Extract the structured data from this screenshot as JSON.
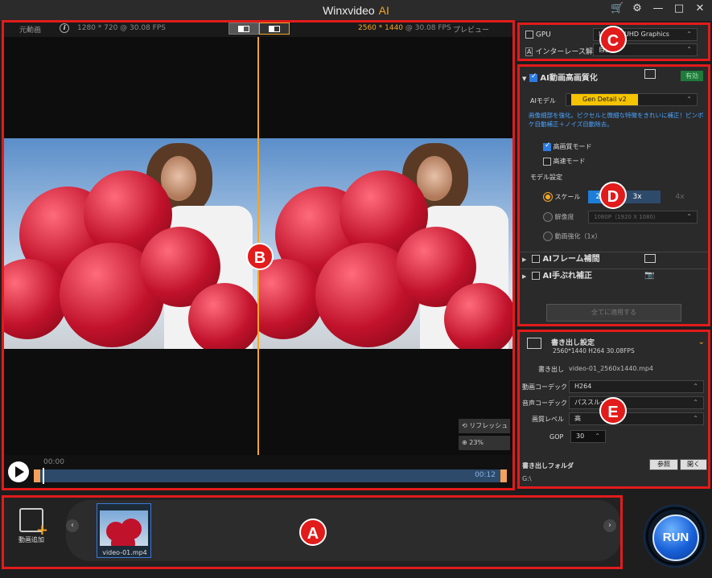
{
  "app": {
    "title": "Winxvideo",
    "title_ai": "AI"
  },
  "preview": {
    "left_label": "元動画",
    "left_res": "1280 * 720 @ 30.08 FPS",
    "right_res_hi": "2560 * 1440",
    "right_res_rest": " @ 30.08 FPS",
    "right_label": "プレビュー",
    "refresh": "リフレッシュ",
    "zoom": "23%",
    "time_start": "00:00",
    "time_end": "00:12"
  },
  "gpu": {
    "gpu_label": "GPU",
    "gpu_value": "Intel(R) UHD Graphics",
    "deint_label": "インターレース解除",
    "deint_value": "自動"
  },
  "ai": {
    "title": "AI動画高画質化",
    "valid": "有効",
    "model_label": "AIモデル",
    "model_value": "Gen Detail v2",
    "desc": "画像細部を強化。ピクセルと微細な特徴をきれいに補正！ピンボケ自動補正＋ノイズ自動除去。",
    "hq_mode": "高画質モード",
    "fast_mode": "高速モード",
    "model_settings": "モデル設定",
    "scale": "スケール",
    "scale_opts": [
      "2x",
      "3x",
      "4x"
    ],
    "resolution": "解像度",
    "resolution_value": "1080P（1920 X 1080）",
    "enhance": "動画強化（1x）",
    "frame_interp": "AIフレーム補間",
    "stabilize": "AI手ぶれ補正",
    "apply_all": "全てに適用する"
  },
  "export": {
    "title": "書き出し設定",
    "summary": "2560*1440  H264  30.08FPS",
    "out_label": "書き出し",
    "out_value": "video-01_2560x1440.mp4",
    "vcodec_label": "動画コーデック",
    "vcodec": "H264",
    "acodec_label": "音声コーデック",
    "acodec": "パススルー",
    "quality_label": "画質レベル",
    "quality": "高",
    "gop_label": "GOP",
    "gop": "30",
    "folder_label": "書き出しフォルダ",
    "folder_path": "G:\\",
    "browse": "参照",
    "open": "開く"
  },
  "bottom": {
    "add_label": "動画追加",
    "file_name": "video-01.mp4",
    "run": "RUN"
  },
  "badges": {
    "a": "A",
    "b": "B",
    "c": "C",
    "d": "D",
    "e": "E"
  },
  "colors": {
    "accent": "#f5a623",
    "annotation": "#e21b1b",
    "run": "#1860d8"
  }
}
